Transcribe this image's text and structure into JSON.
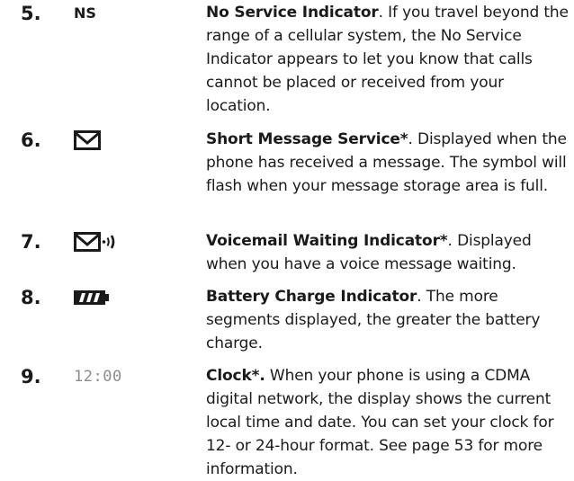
{
  "items": [
    {
      "number": "5.",
      "symbol_text": "NS",
      "title": "No Service Indicator",
      "title_suffix": ".",
      "body": " If you travel beyond the range of a cellular system, the No Service Indicator appears to let you know that calls cannot be placed or received from your location."
    },
    {
      "number": "6.",
      "icon": "envelope-icon",
      "title": "Short Message Service*",
      "title_suffix": ".",
      "body": " Displayed when the phone has received a message. The symbol will flash when your message storage area is full."
    },
    {
      "number": "7.",
      "icon": "voicemail-envelope-icon",
      "title": "Voicemail Waiting Indicator*",
      "title_suffix": ".",
      "body": " Displayed when you have a voice message waiting."
    },
    {
      "number": "8.",
      "icon": "battery-icon",
      "title": "Battery Charge Indicator",
      "title_suffix": ".",
      "body": " The more segments displayed, the greater the battery charge."
    },
    {
      "number": "9.",
      "symbol_text": "12:00",
      "title": "Clock*.",
      "title_suffix": "",
      "body": " When your phone is using a CDMA digital network, the display shows the current local time and date. You can set your clock for 12- or 24-hour format. See page 53 for more information."
    }
  ]
}
